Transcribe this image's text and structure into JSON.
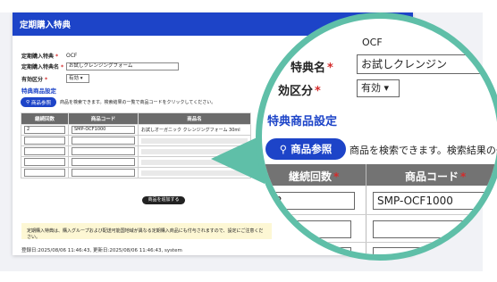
{
  "modal": {
    "title": "定期購入特典",
    "close_label": "×",
    "fields": {
      "benefit_id_label": "定期購入特典",
      "benefit_id_value": "OCF",
      "benefit_name_label": "定期購入特典名",
      "benefit_name_value": "お試しクレンジングフォーム",
      "valid_label": "有効区分",
      "valid_value": "有効"
    },
    "section_title": "特典商品設定",
    "search_button_label": "商品参照",
    "search_help": "商品を検索できます。検索結果の一覧で商品コードをクリックしてください。",
    "table": {
      "headers": [
        "継続回数",
        "商品コード",
        "商品名"
      ],
      "rows": [
        {
          "count": "2",
          "code": "SMP-OCF1000",
          "name": "お試しオーガニック クレンジングフォーム 30ml"
        },
        {
          "count": "",
          "code": "",
          "name": ""
        },
        {
          "count": "",
          "code": "",
          "name": ""
        },
        {
          "count": "",
          "code": "",
          "name": ""
        },
        {
          "count": "",
          "code": "",
          "name": ""
        }
      ]
    },
    "add_button_label": "商品を追加する",
    "notice": "定期購入特典は、購入グループおよび配送可能国地域が異なる定期購入商品にも付与されますので、設定にご注意ください。",
    "footer": "登録日:2025/08/06 11:46:43, 更新日:2025/08/06 11:46:43, system",
    "required_mark": "*"
  },
  "zoom": {
    "ocf": "OCF",
    "label_name": "特典名",
    "input_value": "お試しクレンジン",
    "label_valid": "効区分",
    "select_value": "有効",
    "section": "特典商品設定",
    "search_button": "商品参照",
    "search_text": "商品を検索できます。検索結果の一覧で",
    "header_count": "継続回数",
    "header_code": "商品コード",
    "row_count": "2",
    "row_code": "SMP-OCF1000"
  },
  "colors": {
    "accent": "#1d44c8",
    "zoom_ring": "#5fbfa8",
    "required": "#d42b2b",
    "notice_bg": "#fdf7d4"
  }
}
